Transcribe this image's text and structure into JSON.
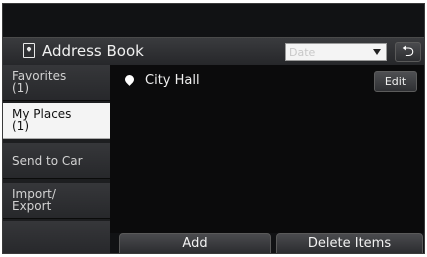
{
  "header": {
    "title": "Address Book",
    "date_select": {
      "placeholder": "Date",
      "value": ""
    },
    "back_symbol": "⮌"
  },
  "sidebar": {
    "items": [
      {
        "line1": "Favorites",
        "line2": "(1)"
      },
      {
        "line1": "My Places",
        "line2": "(1)"
      },
      {
        "line1": "Send to Car"
      },
      {
        "line1": "Import/",
        "line2": "Export"
      }
    ],
    "active_index": 1
  },
  "list": {
    "rows": [
      {
        "label": "City Hall",
        "action": "Edit"
      }
    ]
  },
  "bottom": {
    "add_label": "Add",
    "delete_label": "Delete Items"
  },
  "colors": {
    "background": "#111214",
    "active_tab": "#f4f4f4",
    "text": "#f0f0f0"
  }
}
